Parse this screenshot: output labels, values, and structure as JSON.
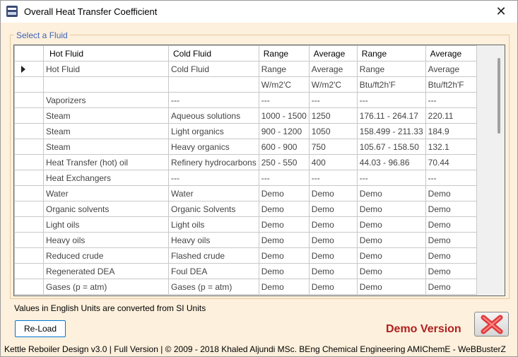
{
  "window": {
    "title": "Overall Heat Transfer Coefficient",
    "close_glyph": "✕"
  },
  "group": {
    "legend": "Select a Fluid"
  },
  "grid": {
    "columns": [
      "Hot Fluid",
      "Cold Fluid",
      "Range",
      "Average",
      "Range",
      "Average"
    ],
    "rows": [
      [
        "Hot Fluid",
        "Cold Fluid",
        "Range",
        "Average",
        "Range",
        "Average"
      ],
      [
        "",
        "",
        "W/m2'C",
        "W/m2'C",
        "Btu/ft2h'F",
        "Btu/ft2h'F"
      ],
      [
        "Vaporizers",
        "---",
        "---",
        "---",
        "---",
        "---"
      ],
      [
        "Steam",
        "Aqueous solutions",
        "1000 - 1500",
        "1250",
        "176.11 - 264.17",
        "220.11"
      ],
      [
        "Steam",
        "Light organics",
        "900 - 1200",
        "1050",
        "158.499 - 211.33",
        "184.9"
      ],
      [
        "Steam",
        "Heavy organics",
        "600 - 900",
        "750",
        "105.67 - 158.50",
        "132.1"
      ],
      [
        "Heat Transfer (hot) oil",
        "Refinery hydrocarbons",
        "250 - 550",
        "400",
        "44.03 - 96.86",
        "70.44"
      ],
      [
        "Heat Exchangers",
        "---",
        "---",
        "---",
        "---",
        "---"
      ],
      [
        "Water",
        "Water",
        "Demo",
        "Demo",
        "Demo",
        "Demo"
      ],
      [
        "Organic solvents",
        "Organic Solvents",
        "Demo",
        "Demo",
        "Demo",
        "Demo"
      ],
      [
        "Light oils",
        "Light oils",
        "Demo",
        "Demo",
        "Demo",
        "Demo"
      ],
      [
        "Heavy oils",
        "Heavy oils",
        "Demo",
        "Demo",
        "Demo",
        "Demo"
      ],
      [
        "Reduced crude",
        "Flashed crude",
        "Demo",
        "Demo",
        "Demo",
        "Demo"
      ],
      [
        "Regenerated DEA",
        "Foul DEA",
        "Demo",
        "Demo",
        "Demo",
        "Demo"
      ],
      [
        "Gases (p = atm)",
        "Gases (p = atm)",
        "Demo",
        "Demo",
        "Demo",
        "Demo"
      ]
    ]
  },
  "note": "Values in English Units are converted from SI Units",
  "buttons": {
    "reload_label": "Re-Load"
  },
  "demo": {
    "label": "Demo Version",
    "label_color": "#b02020"
  },
  "status": {
    "text": "Kettle Reboiler Design  v3.0  |  Full Version  |  © 2009 - 2018 Khaled Aljundi MSc. BEng Chemical Engineering AMIChemE - WeBBusterZ"
  },
  "colors": {
    "window_bg": "#fdf0dc",
    "legend": "#3f63b5",
    "accent_border": "#0078d4",
    "x_icon": "#e23b3b"
  }
}
